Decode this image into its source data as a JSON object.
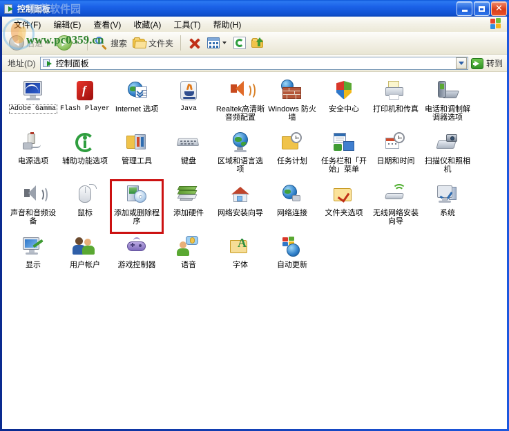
{
  "window": {
    "title": "控制面板",
    "title_icon": "control-panel-icon",
    "buttons": {
      "minimize": "_",
      "maximize": "□",
      "close": "✕"
    }
  },
  "menu": {
    "items": [
      {
        "label": "文件(F)",
        "name": "menu-file"
      },
      {
        "label": "编辑(E)",
        "name": "menu-edit"
      },
      {
        "label": "查看(V)",
        "name": "menu-view"
      },
      {
        "label": "收藏(A)",
        "name": "menu-favorites"
      },
      {
        "label": "工具(T)",
        "name": "menu-tools"
      },
      {
        "label": "帮助(H)",
        "name": "menu-help"
      }
    ]
  },
  "toolbar": {
    "back_label": "后退",
    "forward_label": "",
    "search_label": "搜索",
    "folders_label": "文件夹"
  },
  "address": {
    "label": "地址(D)",
    "value": "控制面板",
    "go_label": "转到"
  },
  "watermark": {
    "site": "www.pc0359.cn",
    "title_overlay": "飘荡软件园"
  },
  "items": [
    {
      "label": "Adobe Gamma",
      "art": "adobe-gamma",
      "selected": true,
      "latin": true
    },
    {
      "label": "Flash Player",
      "art": "flash-player",
      "latin": true
    },
    {
      "label": "Internet 选项",
      "art": "internet-options"
    },
    {
      "label": "Java",
      "art": "java",
      "latin": true
    },
    {
      "label": "Realtek高清晰音频配置",
      "art": "realtek-audio"
    },
    {
      "label": "Windows 防火墙",
      "art": "windows-firewall"
    },
    {
      "label": "安全中心",
      "art": "security-center"
    },
    {
      "label": "打印机和传真",
      "art": "printers-faxes"
    },
    {
      "label": "电话和调制解调器选项",
      "art": "phone-modem"
    },
    {
      "label": "电源选项",
      "art": "power-options"
    },
    {
      "label": "辅助功能选项",
      "art": "accessibility"
    },
    {
      "label": "管理工具",
      "art": "admin-tools"
    },
    {
      "label": "键盘",
      "art": "keyboard"
    },
    {
      "label": "区域和语言选项",
      "art": "regional-language"
    },
    {
      "label": "任务计划",
      "art": "scheduled-tasks"
    },
    {
      "label": "任务栏和「开始」菜单",
      "art": "taskbar-startmenu"
    },
    {
      "label": "日期和时间",
      "art": "date-time"
    },
    {
      "label": "扫描仪和照相机",
      "art": "scanners-cameras"
    },
    {
      "label": "声音和音频设备",
      "art": "sounds-audio"
    },
    {
      "label": "鼠标",
      "art": "mouse"
    },
    {
      "label": "添加或删除程序",
      "art": "add-remove-programs",
      "highlight": true
    },
    {
      "label": "添加硬件",
      "art": "add-hardware"
    },
    {
      "label": "网络安装向导",
      "art": "network-setup-wizard"
    },
    {
      "label": "网络连接",
      "art": "network-connections"
    },
    {
      "label": "文件夹选项",
      "art": "folder-options"
    },
    {
      "label": "无线网络安装向导",
      "art": "wireless-network-wizard"
    },
    {
      "label": "系统",
      "art": "system"
    },
    {
      "label": "显示",
      "art": "display"
    },
    {
      "label": "用户帐户",
      "art": "user-accounts"
    },
    {
      "label": "游戏控制器",
      "art": "game-controllers"
    },
    {
      "label": "语音",
      "art": "speech"
    },
    {
      "label": "字体",
      "art": "fonts"
    },
    {
      "label": "自动更新",
      "art": "automatic-updates"
    }
  ],
  "colors": {
    "title_bar": "#1b62e8",
    "highlight_box": "#cc1111",
    "watermark_green": "#1f7a1f",
    "go_green": "#3f9b33"
  }
}
